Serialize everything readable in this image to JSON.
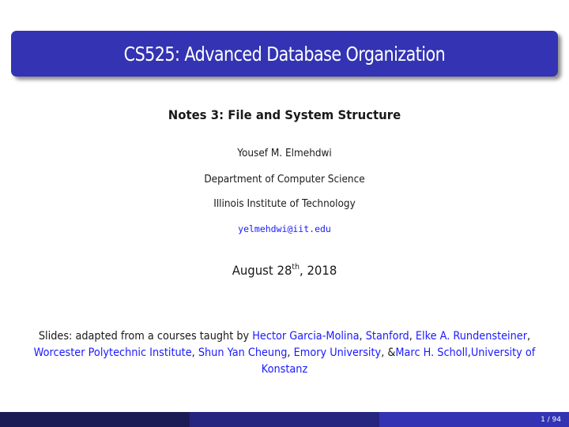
{
  "slide": {
    "title": "CS525: Advanced Database Organization",
    "subtitle": "Notes 3: File and System Structure",
    "author": "Yousef M. Elmehdwi",
    "department": "Department of Computer Science",
    "institution": "Illinois Institute of Technology",
    "email": "yelmehdwi@iit.edu",
    "date": {
      "prefix": "August 28",
      "superscript": "th",
      "suffix": ", 2018"
    },
    "credits": {
      "intro": "Slides: adapted from a courses taught by ",
      "parts": [
        {
          "text": "Hector Garcia-Molina",
          "link": true
        },
        {
          "text": ", ",
          "link": false
        },
        {
          "text": "Stanford",
          "link": true
        },
        {
          "text": ", ",
          "link": false
        },
        {
          "text": "Elke A. Rundensteiner",
          "link": true
        },
        {
          "text": ", ",
          "link": false
        },
        {
          "text": "Worcester Polytechnic Institute",
          "link": true
        },
        {
          "text": ", ",
          "link": false
        },
        {
          "text": "Shun Yan Cheung",
          "link": true
        },
        {
          "text": ", ",
          "link": false
        },
        {
          "text": "Emory University",
          "link": true
        },
        {
          "text": ", &",
          "link": false
        },
        {
          "text": "Marc H. Scholl",
          "link": true
        },
        {
          "text": ",",
          "link": false
        },
        {
          "text": "University of Konstanz",
          "link": true
        }
      ]
    }
  },
  "footer": {
    "page_current": "1",
    "page_total": "94",
    "page_label": "1 / 94"
  },
  "colors": {
    "title_bar": "#3333b3",
    "link": "#1a1aff",
    "footer_left": "#1b1b55",
    "footer_middle": "#262680",
    "footer_right": "#3333b3"
  }
}
